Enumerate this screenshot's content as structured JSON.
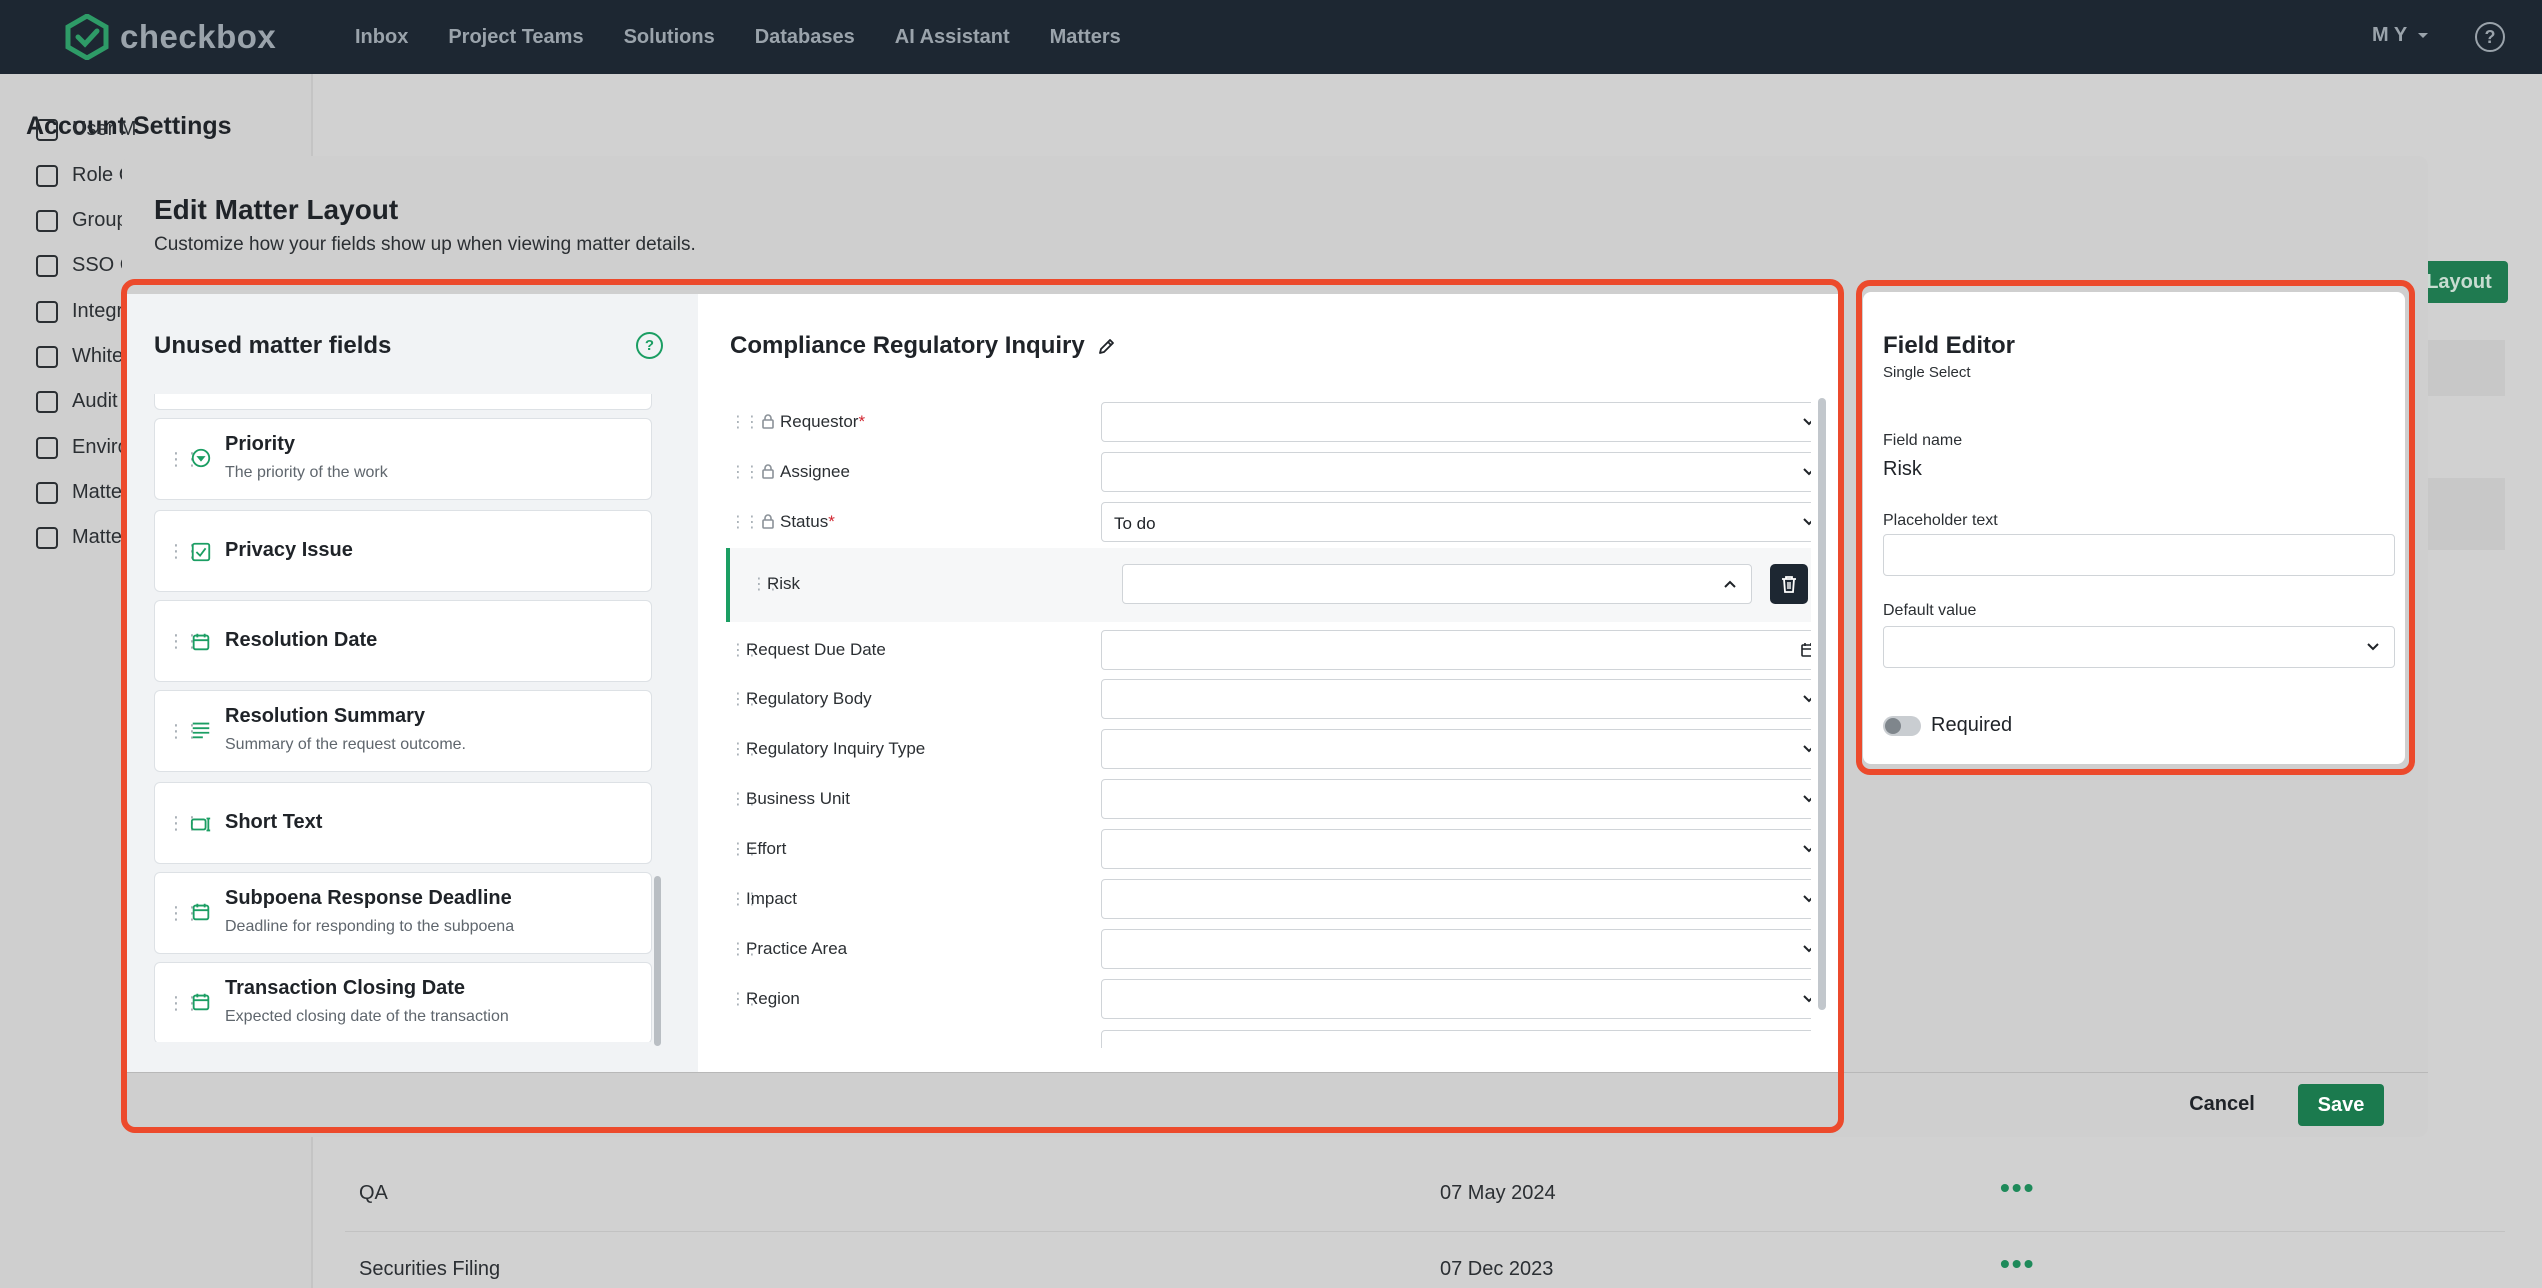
{
  "colors": {
    "accent": "#1b9e63",
    "save": "#1b7a4e",
    "nav_bg": "#1d2732",
    "highlight": "#ec4a2c"
  },
  "nav": {
    "brand": "checkbox",
    "items": [
      "Inbox",
      "Project Teams",
      "Solutions",
      "Databases",
      "AI Assistant",
      "Matters"
    ],
    "user": "M Y"
  },
  "background": {
    "sidebar_title": "Account Settings",
    "sidebar_items": [
      "User M",
      "Role C",
      "Group",
      "SSO C",
      "Integr",
      "White",
      "Audit",
      "Enviro",
      "Matte",
      "Matte"
    ],
    "layout_button": "Layout",
    "rows": [
      {
        "name": "QA",
        "date": "07 May 2024",
        "actions": "•••"
      },
      {
        "name": "Securities Filing",
        "date": "07 Dec 2023",
        "actions": "•••"
      }
    ]
  },
  "modal": {
    "title": "Edit Matter Layout",
    "subtitle": "Customize how your fields show up when viewing matter details.",
    "cancel": "Cancel",
    "save": "Save"
  },
  "unused": {
    "title": "Unused matter fields",
    "fields": [
      {
        "name": "Priority",
        "desc": "The priority of the work",
        "icon": "priority-icon"
      },
      {
        "name": "Privacy Issue",
        "desc": "",
        "icon": "checkbox-icon"
      },
      {
        "name": "Resolution Date",
        "desc": "",
        "icon": "calendar-icon"
      },
      {
        "name": "Resolution Summary",
        "desc": "Summary of the request outcome.",
        "icon": "text-lines-icon"
      },
      {
        "name": "Short Text",
        "desc": "",
        "icon": "short-text-icon"
      },
      {
        "name": "Subpoena Response Deadline",
        "desc": "Deadline for responding to the subpoena",
        "icon": "calendar-icon"
      },
      {
        "name": "Transaction Closing Date",
        "desc": "Expected closing date of the transaction",
        "icon": "calendar-icon"
      }
    ]
  },
  "layout": {
    "title": "Compliance Regulatory Inquiry",
    "rows": [
      {
        "label": "Requestor",
        "required": "*",
        "locked": true,
        "value": "",
        "control": "select"
      },
      {
        "label": "Assignee",
        "required": "",
        "locked": true,
        "value": "",
        "control": "select"
      },
      {
        "label": "Status",
        "required": "*",
        "locked": true,
        "value": "To do",
        "control": "select"
      },
      {
        "label": "Risk",
        "required": "",
        "locked": false,
        "value": "",
        "control": "select-open",
        "active": true
      },
      {
        "label": "Request Due Date",
        "required": "",
        "locked": false,
        "value": "",
        "control": "date"
      },
      {
        "label": "Regulatory Body",
        "required": "",
        "locked": false,
        "value": "",
        "control": "select"
      },
      {
        "label": "Regulatory Inquiry Type",
        "required": "",
        "locked": false,
        "value": "",
        "control": "select"
      },
      {
        "label": "Business Unit",
        "required": "",
        "locked": false,
        "value": "",
        "control": "select"
      },
      {
        "label": "Effort",
        "required": "",
        "locked": false,
        "value": "",
        "control": "select"
      },
      {
        "label": "Impact",
        "required": "",
        "locked": false,
        "value": "",
        "control": "select"
      },
      {
        "label": "Practice Area",
        "required": "",
        "locked": false,
        "value": "",
        "control": "select"
      },
      {
        "label": "Region",
        "required": "",
        "locked": false,
        "value": "",
        "control": "select"
      }
    ]
  },
  "editor": {
    "title": "Field Editor",
    "type": "Single Select",
    "field_name_label": "Field name",
    "field_name": "Risk",
    "placeholder_label": "Placeholder text",
    "placeholder_value": "",
    "default_label": "Default value",
    "default_value": "",
    "required_label": "Required",
    "required_on": false
  }
}
